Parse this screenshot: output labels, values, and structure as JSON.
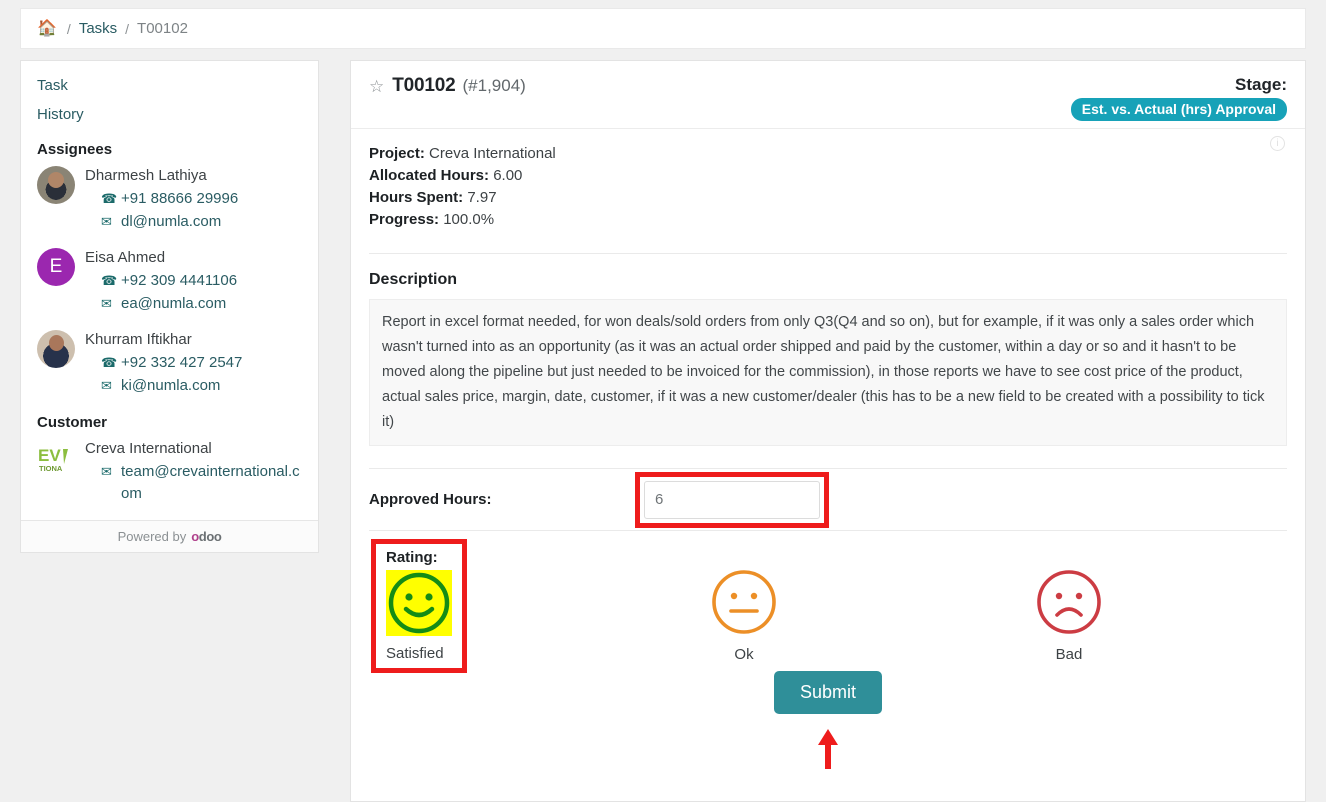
{
  "breadcrumb": {
    "home_icon": "home-icon",
    "separator": "/",
    "items": [
      {
        "label": "Tasks",
        "current": false
      },
      {
        "label": "T00102",
        "current": true
      }
    ]
  },
  "sidebar": {
    "nav": [
      {
        "label": "Task"
      },
      {
        "label": "History"
      }
    ],
    "assignees_heading": "Assignees",
    "assignees": [
      {
        "name": "Dharmesh Lathiya",
        "phone": "+91 88666 29996",
        "email": "dl@numla.com",
        "avatar_type": "photo",
        "initial": ""
      },
      {
        "name": "Eisa Ahmed",
        "phone": "+92 309 4441106",
        "email": "ea@numla.com",
        "avatar_type": "initial",
        "initial": "E"
      },
      {
        "name": "Khurram Iftikhar",
        "phone": "+92 332 427 2547",
        "email": "ki@numla.com",
        "avatar_type": "photo",
        "initial": ""
      }
    ],
    "customer_heading": "Customer",
    "customer": {
      "name": "Creva International",
      "email": "team@crevainternational.com",
      "logo_text": "EV",
      "logo_sub": "TIONA"
    },
    "footer": {
      "text": "Powered by",
      "brand": "odoo"
    }
  },
  "main": {
    "star_icon": "star-outline-icon",
    "task_code": "T00102",
    "task_number": "(#1,904)",
    "stage_label": "Stage:",
    "stage_badge": "Est. vs. Actual (hrs) Approval",
    "info_icon": "info-circle-icon",
    "fields": [
      {
        "label": "Project:",
        "value": "Creva International"
      },
      {
        "label": "Allocated Hours:",
        "value": "6.00"
      },
      {
        "label": "Hours Spent:",
        "value": "7.97"
      },
      {
        "label": "Progress:",
        "value": "100.0%"
      }
    ],
    "description_title": "Description",
    "description_text": "Report in excel format needed, for won deals/sold orders from only Q3(Q4 and so on), but for example, if it was only a sales order which wasn't turned into as an opportunity (as it was an actual order shipped and paid by the customer, within a day or so and it hasn't to be moved along the pipeline but just needed to be invoiced for the commission), in those reports we have to see cost price of the product, actual sales price, margin, date, customer, if it was a new customer/dealer (this has to be a new field to be created with a possibility to tick it)",
    "approved_hours": {
      "label": "Approved Hours:",
      "value": "6",
      "placeholder": "Approved Hours"
    },
    "rating": {
      "label": "Rating:",
      "options": [
        {
          "caption": "Satisfied",
          "icon": "smiley-happy-icon",
          "color": "#158c16",
          "selected": true
        },
        {
          "caption": "Ok",
          "icon": "smiley-neutral-icon",
          "color": "#ec8f27",
          "selected": false
        },
        {
          "caption": "Bad",
          "icon": "smiley-sad-icon",
          "color": "#cc3c43",
          "selected": false
        }
      ],
      "selected_highlight": "#ffff00"
    },
    "submit_label": "Submit"
  },
  "annotations": {
    "highlight_color": "#ee1c1c",
    "arrow_icon": "arrow-up-annotation"
  }
}
